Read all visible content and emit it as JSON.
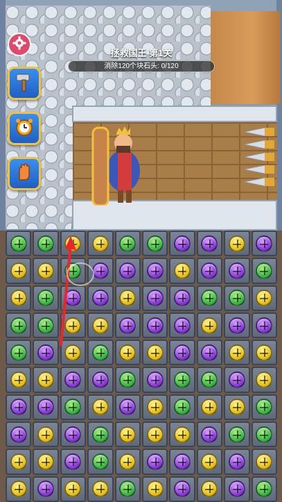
{
  "level": {
    "title": "拯救国王 第1关",
    "goal_text": "消除120个块石头: 0/120"
  },
  "buttons": {
    "settings_icon": "gear-icon",
    "tools": [
      {
        "name": "hammer-tool",
        "icon": "hammer-icon"
      },
      {
        "name": "alarm-clock-tool",
        "icon": "alarm-clock-icon"
      },
      {
        "name": "glove-tool",
        "icon": "glove-icon"
      }
    ]
  },
  "colors": {
    "yellow": "#e9c21a",
    "green": "#3fb84a",
    "purple": "#8a3fd8",
    "settings": "#e04a6a",
    "tool_border": "#f3c23b"
  },
  "grid": {
    "rows": [
      [
        "green",
        "green",
        "yellow",
        "yellow",
        "green",
        "green",
        "purple",
        "purple",
        "yellow",
        "purple"
      ],
      [
        "yellow",
        "yellow",
        "green",
        "purple",
        "purple",
        "purple",
        "yellow",
        "purple",
        "purple",
        "green"
      ],
      [
        "yellow",
        "green",
        "purple",
        "purple",
        "yellow",
        "purple",
        "purple",
        "green",
        "green",
        "yellow"
      ],
      [
        "green",
        "green",
        "yellow",
        "yellow",
        "purple",
        "purple",
        "purple",
        "yellow",
        "purple",
        "purple"
      ],
      [
        "green",
        "purple",
        "yellow",
        "green",
        "yellow",
        "yellow",
        "purple",
        "purple",
        "yellow",
        "yellow"
      ],
      [
        "yellow",
        "yellow",
        "purple",
        "purple",
        "green",
        "purple",
        "green",
        "green",
        "purple",
        "yellow"
      ],
      [
        "purple",
        "purple",
        "green",
        "yellow",
        "purple",
        "yellow",
        "green",
        "yellow",
        "yellow",
        "green"
      ],
      [
        "purple",
        "yellow",
        "purple",
        "green",
        "yellow",
        "yellow",
        "yellow",
        "purple",
        "green",
        "green"
      ],
      [
        "yellow",
        "yellow",
        "purple",
        "green",
        "yellow",
        "purple",
        "purple",
        "yellow",
        "purple",
        "yellow"
      ],
      [
        "yellow",
        "purple",
        "yellow",
        "yellow",
        "green",
        "yellow",
        "purple",
        "yellow",
        "purple",
        "green"
      ]
    ]
  }
}
